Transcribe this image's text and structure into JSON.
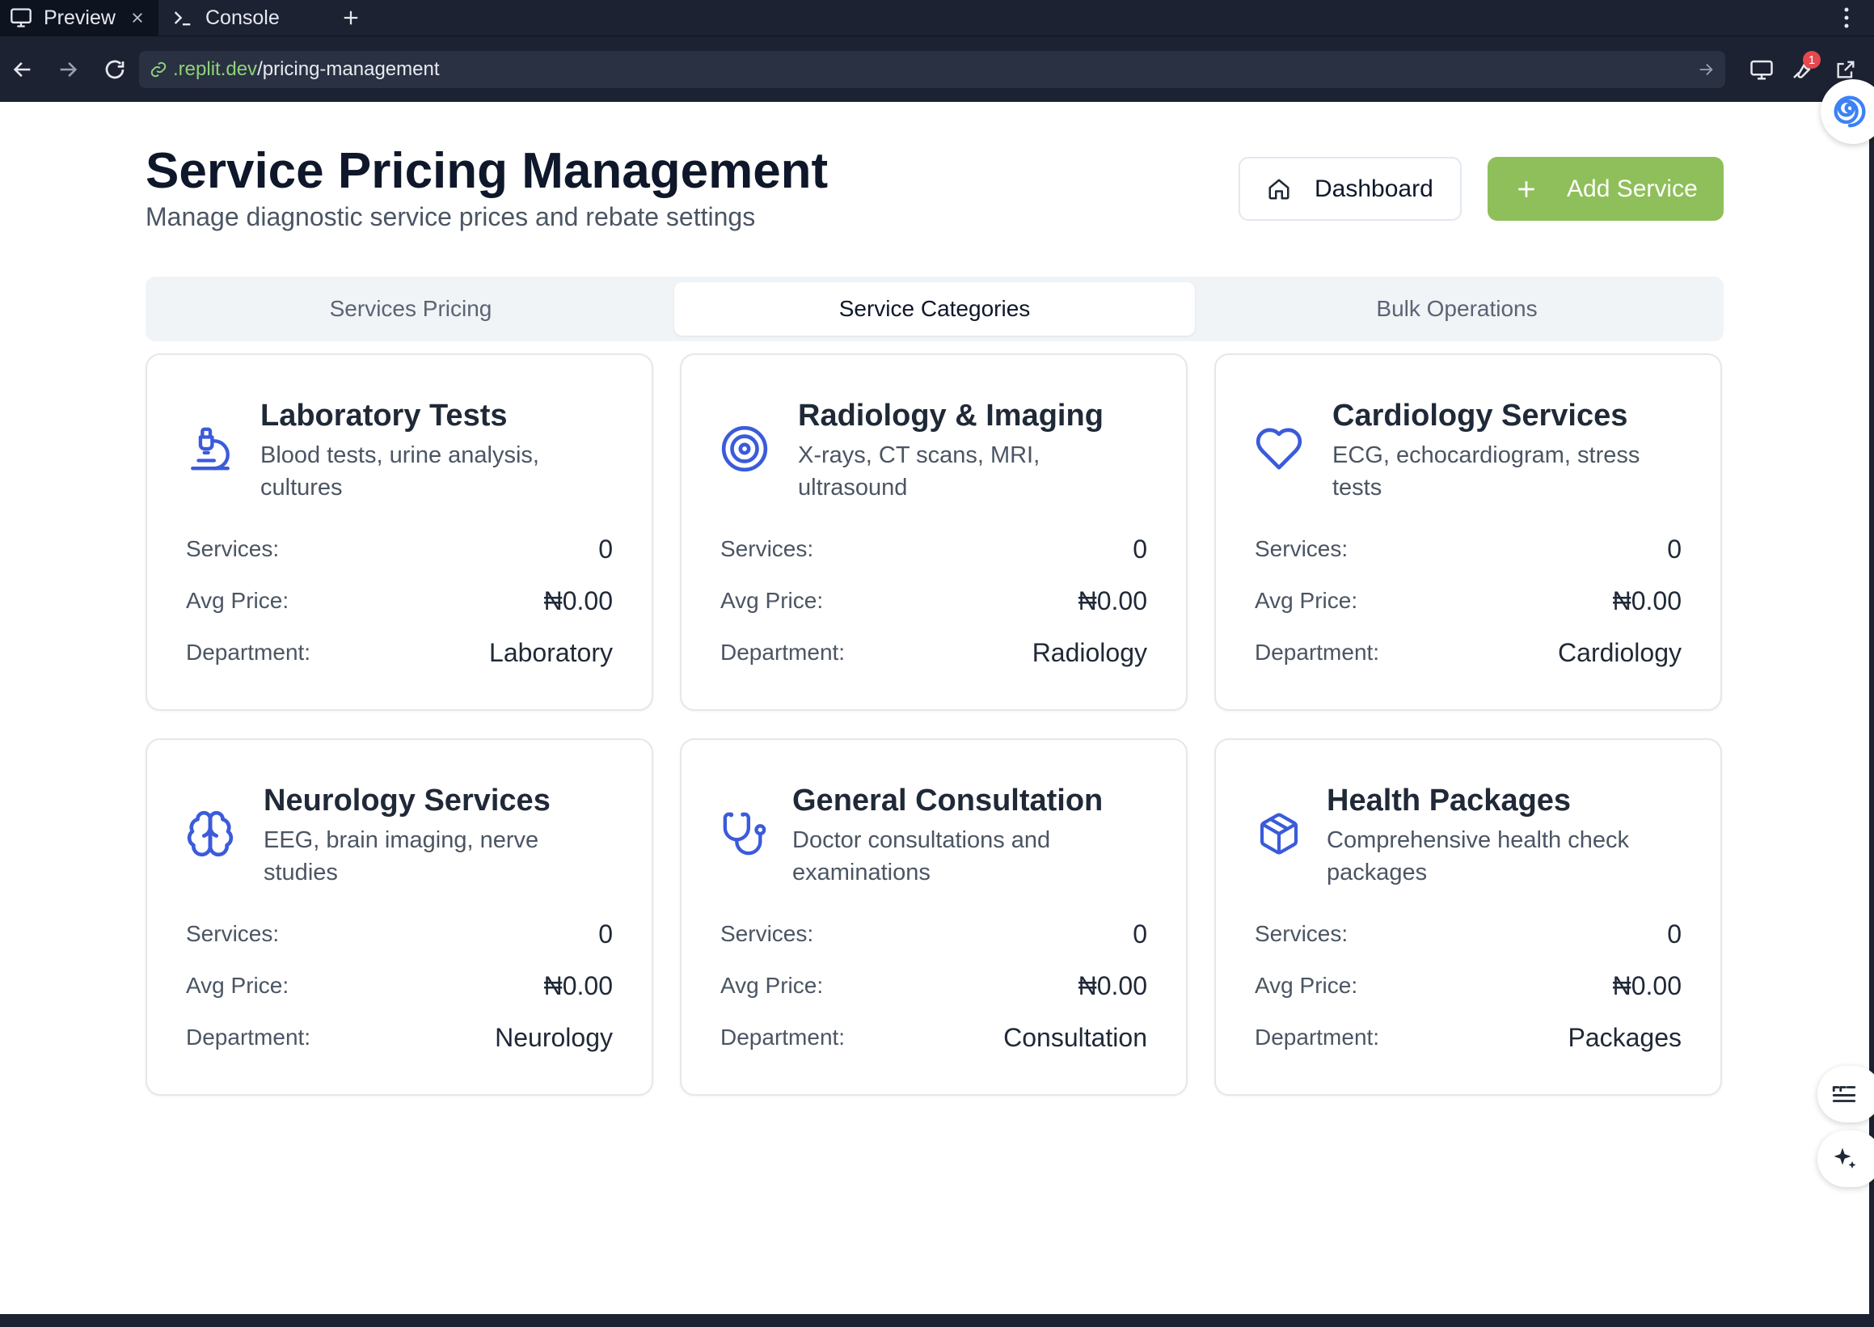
{
  "browser": {
    "tabs": [
      {
        "label": "Preview",
        "icon": "monitor-icon"
      },
      {
        "label": "Console",
        "icon": "terminal-icon"
      }
    ],
    "url_domain": ".replit.dev",
    "url_path": "/pricing-management",
    "notification_count": "1"
  },
  "header": {
    "title": "Service Pricing Management",
    "subtitle": "Manage diagnostic service prices and rebate settings",
    "dashboard_label": "Dashboard",
    "add_service_label": "Add Service"
  },
  "tabs": [
    {
      "label": "Services Pricing",
      "active": false
    },
    {
      "label": "Service Categories",
      "active": true
    },
    {
      "label": "Bulk Operations",
      "active": false
    }
  ],
  "labels": {
    "services": "Services:",
    "avg_price": "Avg Price:",
    "department": "Department:"
  },
  "categories": [
    {
      "title": "Laboratory Tests",
      "description": "Blood tests, urine analysis, cultures",
      "icon": "microscope-icon",
      "services": "0",
      "avg_price": "₦0.00",
      "department": "Laboratory"
    },
    {
      "title": "Radiology & Imaging",
      "description": "X-rays, CT scans, MRI, ultrasound",
      "icon": "target-icon",
      "services": "0",
      "avg_price": "₦0.00",
      "department": "Radiology"
    },
    {
      "title": "Cardiology Services",
      "description": "ECG, echocardiogram, stress tests",
      "icon": "heart-icon",
      "services": "0",
      "avg_price": "₦0.00",
      "department": "Cardiology"
    },
    {
      "title": "Neurology Services",
      "description": "EEG, brain imaging, nerve studies",
      "icon": "brain-icon",
      "services": "0",
      "avg_price": "₦0.00",
      "department": "Neurology"
    },
    {
      "title": "General Consultation",
      "description": "Doctor consultations and examinations",
      "icon": "stethoscope-icon",
      "services": "0",
      "avg_price": "₦0.00",
      "department": "Consultation"
    },
    {
      "title": "Health Packages",
      "description": "Comprehensive health check packages",
      "icon": "package-icon",
      "services": "0",
      "avg_price": "₦0.00",
      "department": "Packages"
    }
  ],
  "colors": {
    "accent_icon": "#3b5bdb",
    "add_button": "#8fbf5a",
    "chrome": "#1c2232"
  }
}
